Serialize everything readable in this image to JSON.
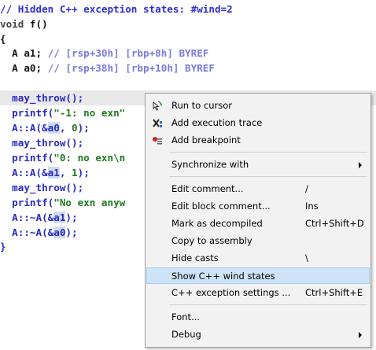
{
  "code": [
    {
      "segs": [
        {
          "t": "// Hidden C++ exception states: #wind=2",
          "c": "cm"
        }
      ]
    },
    {
      "segs": [
        {
          "t": "void",
          "c": "kw"
        },
        {
          "t": " f()",
          "c": "blk"
        }
      ]
    },
    {
      "segs": [
        {
          "t": "{",
          "c": "blk"
        }
      ]
    },
    {
      "segs": [
        {
          "t": "  A a1; ",
          "c": "blk"
        },
        {
          "t": "// [rsp+30h] [rbp+8h] BYREF",
          "c": "cmg"
        }
      ]
    },
    {
      "segs": [
        {
          "t": "  A a0; ",
          "c": "blk"
        },
        {
          "t": "// [rsp+38h] [rbp+10h] BYREF",
          "c": "cmg"
        }
      ]
    },
    {
      "segs": []
    },
    {
      "segs": [
        {
          "t": "  may_throw();",
          "c": "fn"
        }
      ],
      "hl": true
    },
    {
      "segs": [
        {
          "t": "  printf(",
          "c": "fn"
        },
        {
          "t": "\"-1: no exn\"",
          "c": "str"
        }
      ]
    },
    {
      "segs": [
        {
          "t": "  A::A(&",
          "c": "fn"
        },
        {
          "t": "a0",
          "c": "var",
          "h": true
        },
        {
          "t": ", ",
          "c": "fn"
        },
        {
          "t": "0",
          "c": "num"
        },
        {
          "t": ");",
          "c": "fn"
        }
      ]
    },
    {
      "segs": [
        {
          "t": "  may_throw();",
          "c": "fn"
        }
      ]
    },
    {
      "segs": [
        {
          "t": "  printf(",
          "c": "fn"
        },
        {
          "t": "\"0: no exn\\n",
          "c": "str"
        }
      ]
    },
    {
      "segs": [
        {
          "t": "  A::A(&",
          "c": "fn"
        },
        {
          "t": "a1",
          "c": "var",
          "h": true
        },
        {
          "t": ", ",
          "c": "fn"
        },
        {
          "t": "1",
          "c": "num"
        },
        {
          "t": ");",
          "c": "fn"
        }
      ]
    },
    {
      "segs": [
        {
          "t": "  may_throw();",
          "c": "fn"
        }
      ]
    },
    {
      "segs": [
        {
          "t": "  printf(",
          "c": "fn"
        },
        {
          "t": "\"No exn anyw",
          "c": "str"
        }
      ]
    },
    {
      "segs": [
        {
          "t": "  A::~A(&",
          "c": "fn"
        },
        {
          "t": "a1",
          "c": "var",
          "h": true
        },
        {
          "t": ");",
          "c": "fn"
        }
      ]
    },
    {
      "segs": [
        {
          "t": "  A::~A(&",
          "c": "fn"
        },
        {
          "t": "a0",
          "c": "var",
          "h": true
        },
        {
          "t": ");",
          "c": "fn"
        }
      ]
    },
    {
      "segs": [
        {
          "t": "}",
          "c": "fn"
        }
      ]
    }
  ],
  "menu": {
    "items": [
      {
        "label": "Run to cursor",
        "shortcut": "",
        "icon": "run-to-cursor-icon"
      },
      {
        "label": "Add execution trace",
        "shortcut": "",
        "icon": "execution-trace-icon"
      },
      {
        "label": "Add breakpoint",
        "shortcut": "",
        "icon": "breakpoint-icon"
      },
      {
        "label": "Synchronize with",
        "shortcut": "",
        "icon": "",
        "submenu": true
      },
      {
        "label": "Edit comment...",
        "shortcut": "/",
        "icon": ""
      },
      {
        "label": "Edit block comment...",
        "shortcut": "Ins",
        "icon": ""
      },
      {
        "label": "Mark as decompiled",
        "shortcut": "Ctrl+Shift+D",
        "icon": ""
      },
      {
        "label": "Copy to assembly",
        "shortcut": "",
        "icon": ""
      },
      {
        "label": "Hide casts",
        "shortcut": "\\",
        "icon": ""
      },
      {
        "label": "Show C++ wind states",
        "shortcut": "",
        "icon": "",
        "active": true
      },
      {
        "label": "C++ exception settings ...",
        "shortcut": "Ctrl+Shift+E",
        "icon": ""
      },
      {
        "label": "Font...",
        "shortcut": "",
        "icon": ""
      },
      {
        "label": "Debug",
        "shortcut": "",
        "icon": "",
        "submenu": true
      }
    ]
  }
}
